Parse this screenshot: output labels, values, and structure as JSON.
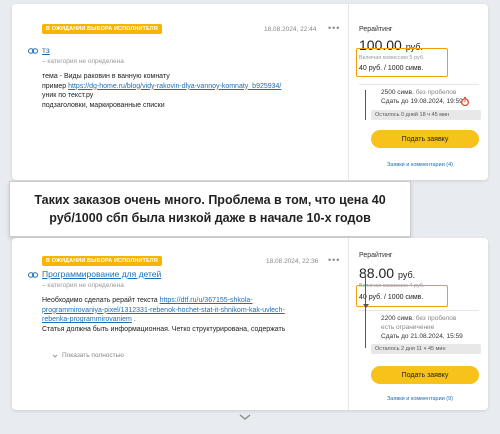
{
  "colors": {
    "badge": "#f7b500",
    "link": "#1a6fb8",
    "button": "#f7c21a",
    "highlight": "#f29f05",
    "timer": "#e04a2c"
  },
  "cards": [
    {
      "badge": "В ОЖИДАНИИ ВЫБОРА ИСПОЛНИТЕЛЯ",
      "date": "18.08.2024, 22:44",
      "menu": "•••",
      "title": "тз",
      "category": "– категория не определена",
      "body": {
        "line1": "тема - Виды раковин в ванную комнату",
        "line2_prefix": "пример ",
        "line2_link": "https://dg-home.ru/blog/vidy-rakovin-dlya-vannoy-komnaty_b925934/",
        "line3": "уник по текст.ру",
        "line4": "подзаголовки, маркированные списки"
      },
      "right": {
        "label": "Рерайтинг",
        "price": "100.00",
        "currency": "руб.",
        "commission": "Включая комиссию 5 руб.",
        "rate": "40 руб. / 1000 симв.",
        "size": "2500 симв.",
        "size_note": "без пробелов",
        "deadline": "Сдать до 19.08.2024, 19:59",
        "remaining": "Осталось 0 дней 18 ч 45 мин",
        "button": "Подать заявку",
        "comments": "Заявки и комментарии (4)"
      }
    },
    {
      "badge": "В ОЖИДАНИИ ВЫБОРА ИСПОЛНИТЕЛЯ",
      "date": "18.08.2024, 22:36",
      "menu": "•••",
      "title": "Программирование для детей",
      "category": "– категория не определена",
      "body": {
        "line1_prefix": "Необходимо сделать рерайт текста ",
        "line1_link": "https://dtf.ru/u/367155-shkola-",
        "line2_link": "programmirovaniya-pixel/1312331-rebenok-hochet-stat-it-shnikom-kak-uvlech-",
        "line3_link": "rebenka-programmirovaniem",
        "line3_suffix": " .",
        "line4": "Статья должна быть информационная. Четко структурирована, содержать"
      },
      "show_more": "Показать полностью",
      "right": {
        "label": "Рерайтинг",
        "price": "88.00",
        "currency": "руб.",
        "commission": "Включая комиссию 4 руб.",
        "rate": "40 руб. / 1000 симв.",
        "size": "2200 симв.",
        "size_note": "без пробелов",
        "size_note2": "есть ограничение",
        "deadline": "Сдать до 21.08.2024, 15:59",
        "remaining": "Осталось 2 дня 11 ч 45 мин",
        "button": "Подать заявку",
        "comments": "Заявки и комментарии (9)"
      }
    }
  ],
  "banner": {
    "line1": "Таких заказов очень много. Проблема в том, что цена 40",
    "line2": "руб/1000 сбп была низкой даже в начале 10-х годов"
  }
}
